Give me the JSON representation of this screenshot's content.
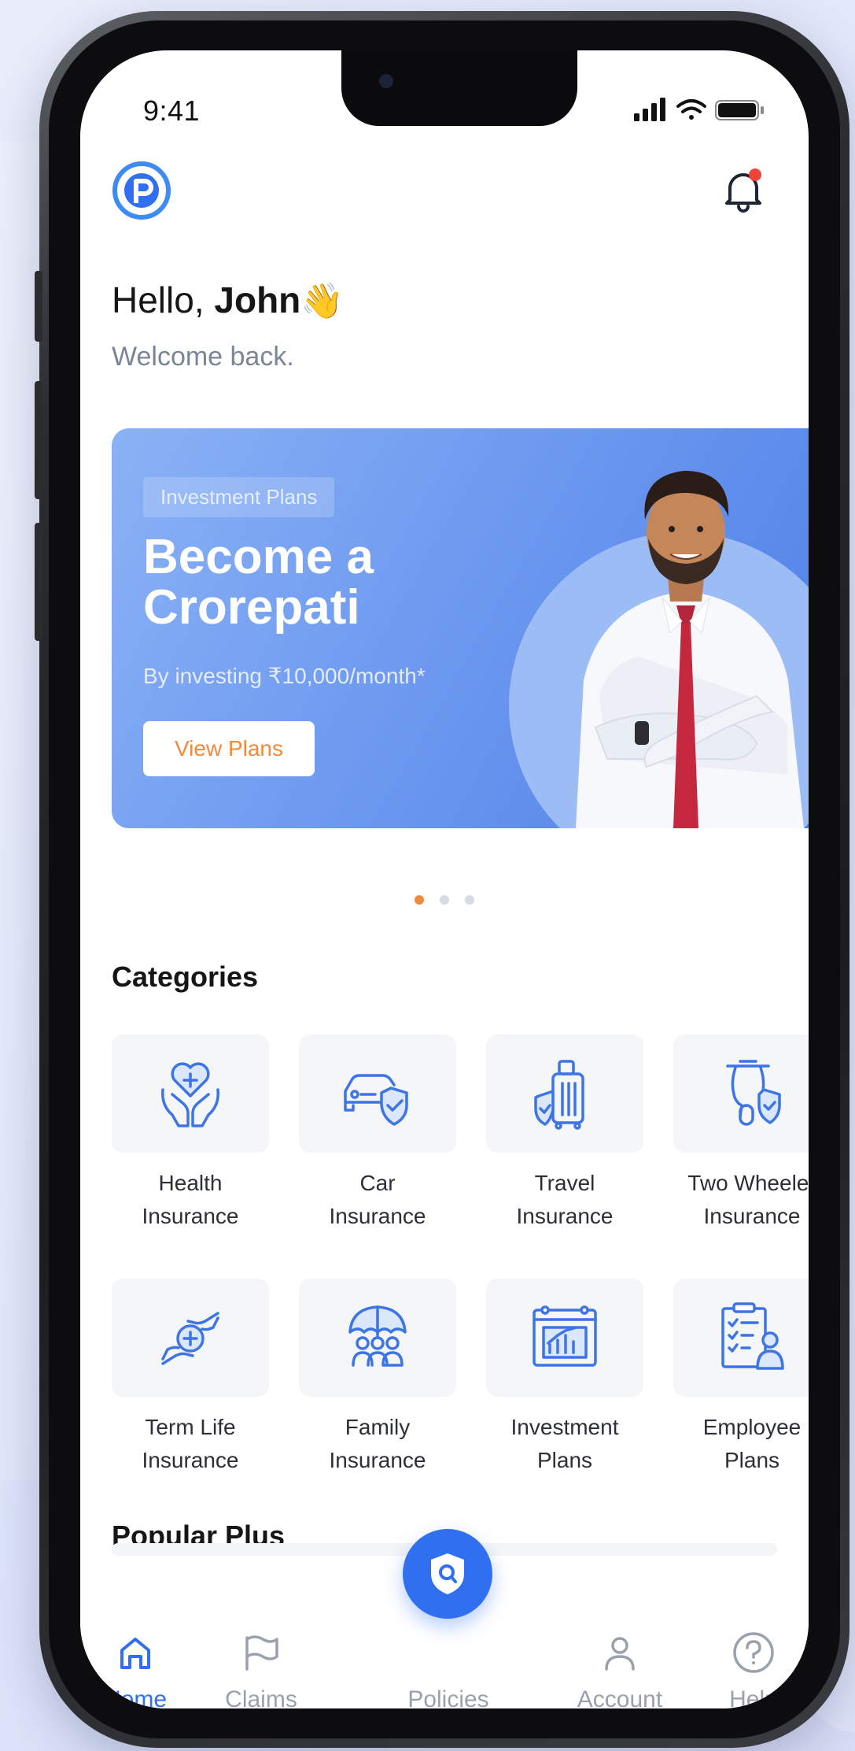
{
  "status_bar": {
    "time": "9:41"
  },
  "header": {
    "logo_icon": "p-logo-icon",
    "notification_icon": "bell-icon",
    "notification_badge_color": "#f04438"
  },
  "greeting": {
    "hello": "Hello,",
    "name": "John",
    "wave": "👋",
    "subtitle": "Welcome back."
  },
  "banner": {
    "tag": "Investment Plans",
    "title": "Become a Crorepati",
    "subtitle": "By investing ₹10,000/month*",
    "button_label": "View Plans",
    "carousel_total": 3,
    "carousel_active": 0
  },
  "categories": {
    "title": "Categories",
    "items": [
      {
        "line1": "Health",
        "line2": "Insurance",
        "icon": "health-insurance-icon"
      },
      {
        "line1": "Car",
        "line2": "Insurance",
        "icon": "car-insurance-icon"
      },
      {
        "line1": "Travel",
        "line2": "Insurance",
        "icon": "travel-insurance-icon"
      },
      {
        "line1": "Two Wheeler",
        "line2": "Insurance",
        "icon": "two-wheeler-insurance-icon"
      },
      {
        "line1": "Term Life",
        "line2": "Insurance",
        "icon": "term-life-insurance-icon"
      },
      {
        "line1": "Family",
        "line2": "Insurance",
        "icon": "family-insurance-icon"
      },
      {
        "line1": "Investment",
        "line2": "Plans",
        "icon": "investment-plans-icon"
      },
      {
        "line1": "Employee",
        "line2": "Plans",
        "icon": "employee-plans-icon"
      }
    ]
  },
  "popular": {
    "title": "Popular Plus"
  },
  "nav": {
    "items": [
      {
        "label": "Home",
        "icon": "home-icon",
        "active": true
      },
      {
        "label": "Claims",
        "icon": "flag-icon",
        "active": false
      },
      {
        "label": "Policies",
        "icon": "shield-search-icon",
        "active": false
      },
      {
        "label": "Account",
        "icon": "user-icon",
        "active": false
      },
      {
        "label": "Help",
        "icon": "help-icon",
        "active": false
      }
    ]
  },
  "colors": {
    "primary": "#2f6ff0",
    "accent_orange": "#f08a3c",
    "icon_blue": "#3d74e6"
  }
}
